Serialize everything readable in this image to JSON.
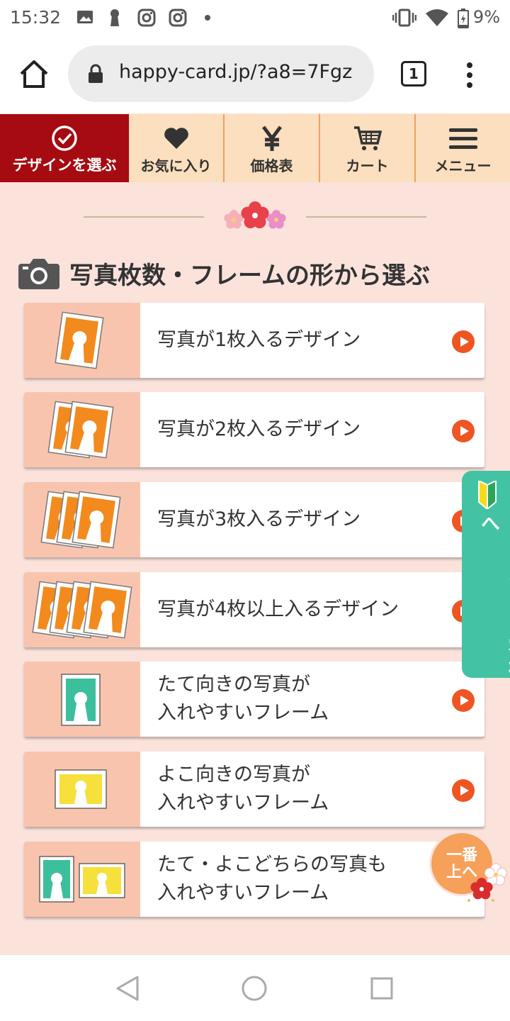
{
  "status_bar": {
    "time": "15:32",
    "battery_percent": "9%",
    "icons": [
      "image-icon",
      "keyhole-icon",
      "instagram-icon",
      "instagram-icon",
      "dot-icon",
      "vibrate-icon",
      "wifi-icon",
      "battery-icon"
    ]
  },
  "browser": {
    "url": "happy-card.jp/?a8=7Fgz",
    "tab_count": "1"
  },
  "site_nav": {
    "items": [
      {
        "label": "デザインを選ぶ",
        "icon": "check-circle-icon"
      },
      {
        "label": "お気に入り",
        "icon": "heart-icon"
      },
      {
        "label": "価格表",
        "icon": "yen-icon"
      },
      {
        "label": "カート",
        "icon": "cart-icon"
      },
      {
        "label": "メニュー",
        "icon": "hamburger-icon"
      }
    ],
    "active_color": "#a50b10"
  },
  "section": {
    "title": "写真枚数・フレームの形から選ぶ",
    "icon": "camera-icon"
  },
  "cards": [
    {
      "line1": "写真が1枚入るデザイン",
      "line2": ""
    },
    {
      "line1": "写真が2枚入るデザイン",
      "line2": ""
    },
    {
      "line1": "写真が3枚入るデザイン",
      "line2": ""
    },
    {
      "line1": "写真が4枚以上入るデザイン",
      "line2": ""
    },
    {
      "line1": "たて向きの写真が",
      "line2": "入れやすいフレーム"
    },
    {
      "line1": "よこ向きの写真が",
      "line2": "入れやすいフレーム"
    },
    {
      "line1": "たて・よこどちらの写真も",
      "line2": "入れやすいフレーム"
    }
  ],
  "side_tab": {
    "label": "はじめてのお客様へ"
  },
  "to_top": {
    "line1": "一番",
    "line2": "上へ"
  },
  "colors": {
    "page_bg": "#fbe3dc",
    "nav_bg": "#fbdfbe",
    "thumb_bg": "#f9c4ae",
    "arrow": "#ee5522",
    "side_tab": "#43c3a3",
    "orange_photo": "#f28a1e",
    "green_photo": "#3cbf9c",
    "yellow_photo": "#f6e03c"
  }
}
